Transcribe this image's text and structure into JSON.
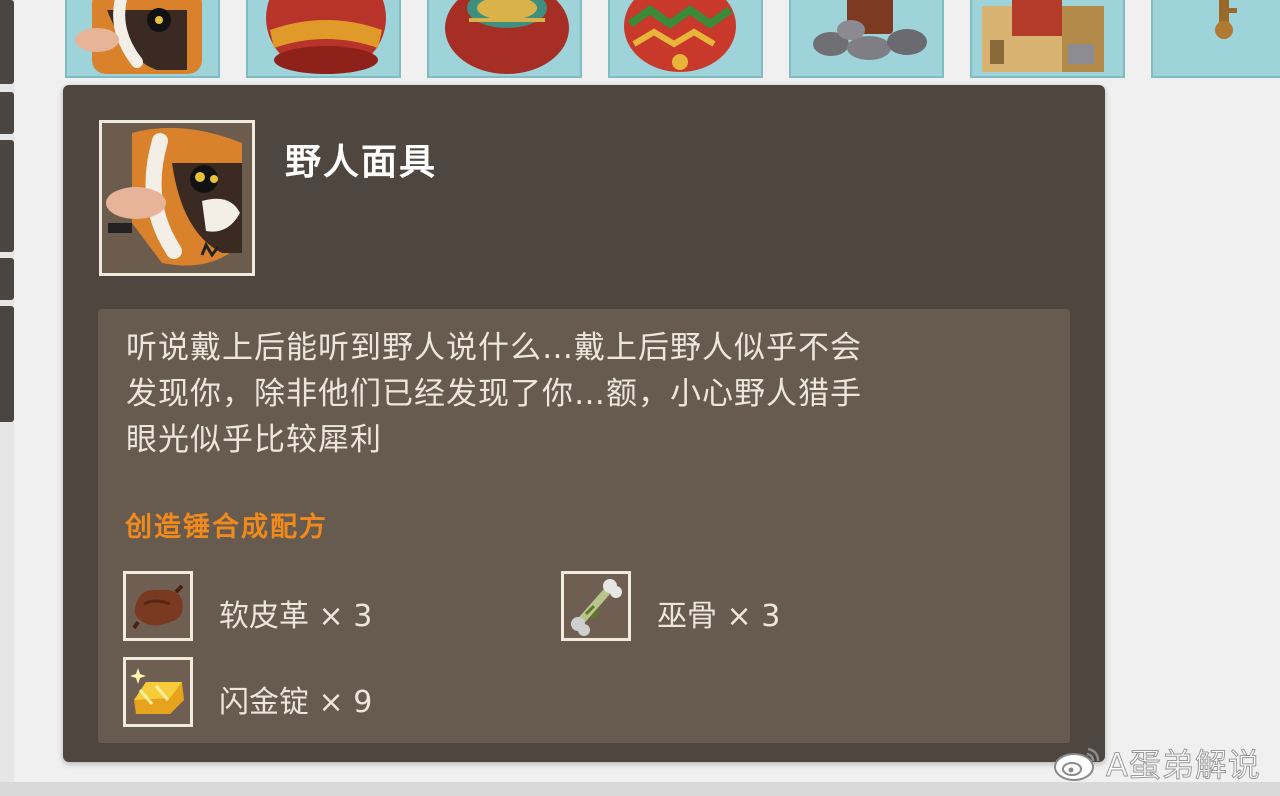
{
  "item": {
    "name": "野人面具",
    "icon": "savage-mask-icon",
    "description_lines": [
      "听说戴上后能听到野人说什么…戴上后野人似乎不会",
      "发现你，除非他们已经发现了你…额，小心野人猎手",
      "眼光似乎比较犀利"
    ]
  },
  "recipe": {
    "title": "创造锤合成配方",
    "ingredients": [
      {
        "name": "软皮革",
        "qty_text": "× 3",
        "icon": "soft-leather-icon"
      },
      {
        "name": "巫骨",
        "qty_text": "× 3",
        "icon": "witch-bone-icon"
      },
      {
        "name": "闪金锭",
        "qty_text": "× 9",
        "icon": "gold-ingot-icon"
      }
    ]
  },
  "slots": [
    {
      "icon": "savage-mask-icon"
    },
    {
      "icon": "red-helmet-icon"
    },
    {
      "icon": "tribal-helmet-icon"
    },
    {
      "icon": "painted-egg-icon"
    },
    {
      "icon": "campfire-icon"
    },
    {
      "icon": "castle-block-icon"
    },
    {
      "icon": "key-icon"
    }
  ],
  "watermark": {
    "text": "A蛋弟解说",
    "icon": "weibo-icon"
  },
  "colors": {
    "panel_bg": "#4f4640",
    "desc_bg": "#675a4e",
    "recipe_title": "#f08a1c",
    "slot_bg": "#9ed3da"
  }
}
